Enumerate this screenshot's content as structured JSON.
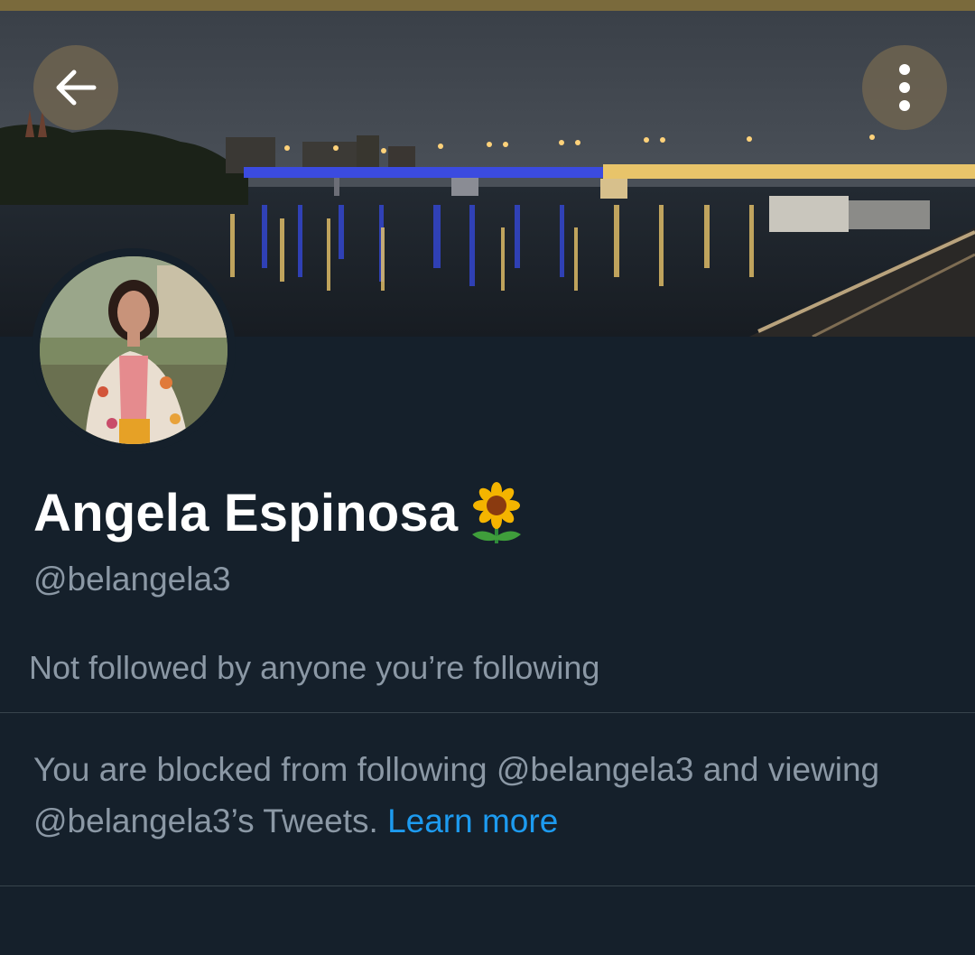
{
  "header": {
    "back_icon": "arrow-left-icon",
    "more_icon": "more-vertical-icon"
  },
  "profile": {
    "display_name": "Angela Espinosa",
    "name_emoji": "sunflower",
    "handle": "@belangela3",
    "followed_by_text": "Not followed by anyone you’re following"
  },
  "blocked_notice": {
    "text": "You are blocked from following @belangela3 and viewing @belangela3’s Tweets.",
    "link_label": "Learn more"
  },
  "colors": {
    "background": "#15202b",
    "primary_text": "#ffffff",
    "secondary_text": "#8b98a5",
    "link": "#1d9bf0",
    "divider": "#38444d"
  }
}
